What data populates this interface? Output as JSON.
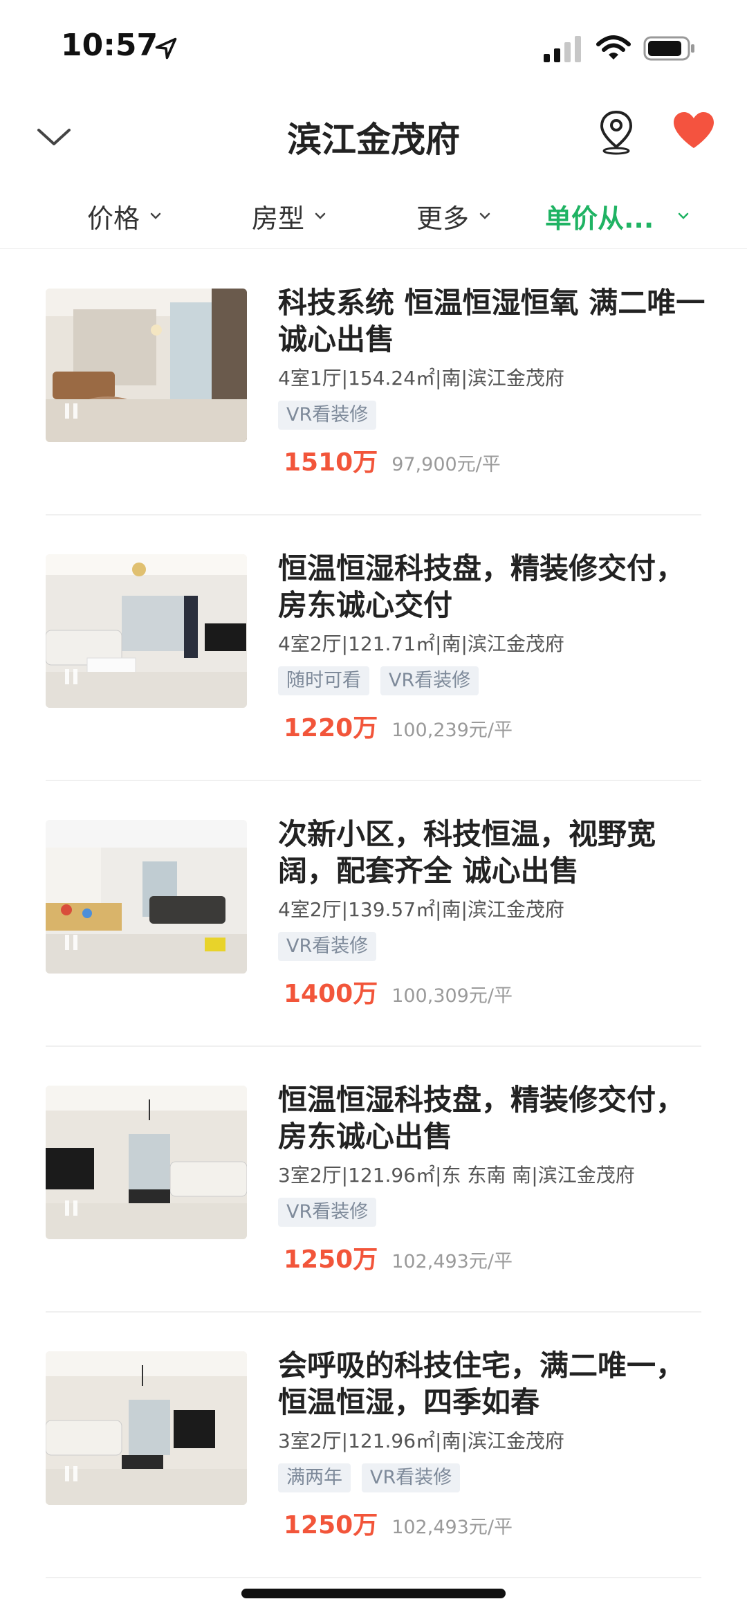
{
  "status_bar": {
    "time": "10:57"
  },
  "header": {
    "title": "滨江金茂府"
  },
  "filters": [
    {
      "label": "价格",
      "active": false
    },
    {
      "label": "房型",
      "active": false
    },
    {
      "label": "更多",
      "active": false
    },
    {
      "label": "单价从...",
      "active": true
    }
  ],
  "listings": [
    {
      "title": "科技系统 恒温恒湿恒氧 满二唯一 诚心出售",
      "meta": "4室1厅|154.24㎡|南|滨江金茂府",
      "tags": [
        "VR看装修"
      ],
      "price": "1510万",
      "unit_price": "97,900元/平",
      "photo_scheme": "warm"
    },
    {
      "title": "恒温恒湿科技盘，精装修交付，房东诚心交付",
      "meta": "4室2厅|121.71㎡|南|滨江金茂府",
      "tags": [
        "随时可看",
        "VR看装修"
      ],
      "price": "1220万",
      "unit_price": "100,239元/平",
      "photo_scheme": "white"
    },
    {
      "title": "次新小区，科技恒温，视野宽阔，配套齐全 诚心出售",
      "meta": "4室2厅|139.57㎡|南|滨江金茂府",
      "tags": [
        "VR看装修"
      ],
      "price": "1400万",
      "unit_price": "100,309元/平",
      "photo_scheme": "kids"
    },
    {
      "title": "恒温恒湿科技盘，精装修交付，房东诚心出售",
      "meta": "3室2厅|121.96㎡|东 东南 南|滨江金茂府",
      "tags": [
        "VR看装修"
      ],
      "price": "1250万",
      "unit_price": "102,493元/平",
      "photo_scheme": "dark_tv"
    },
    {
      "title": "会呼吸的科技住宅，满二唯一，恒温恒湿，四季如春",
      "meta": "3室2厅|121.96㎡|南|滨江金茂府",
      "tags": [
        "满两年",
        "VR看装修"
      ],
      "price": "1250万",
      "unit_price": "102,493元/平",
      "photo_scheme": "dark_tv"
    }
  ],
  "colors": {
    "accent_green": "#1fb363",
    "price_red": "#f2553a",
    "heart_red": "#f4533f"
  },
  "icons": [
    "navigation-arrow-icon",
    "signal-icon",
    "wifi-icon",
    "battery-icon",
    "chevron-down-icon",
    "map-pin-icon",
    "heart-icon",
    "pause-icon"
  ]
}
